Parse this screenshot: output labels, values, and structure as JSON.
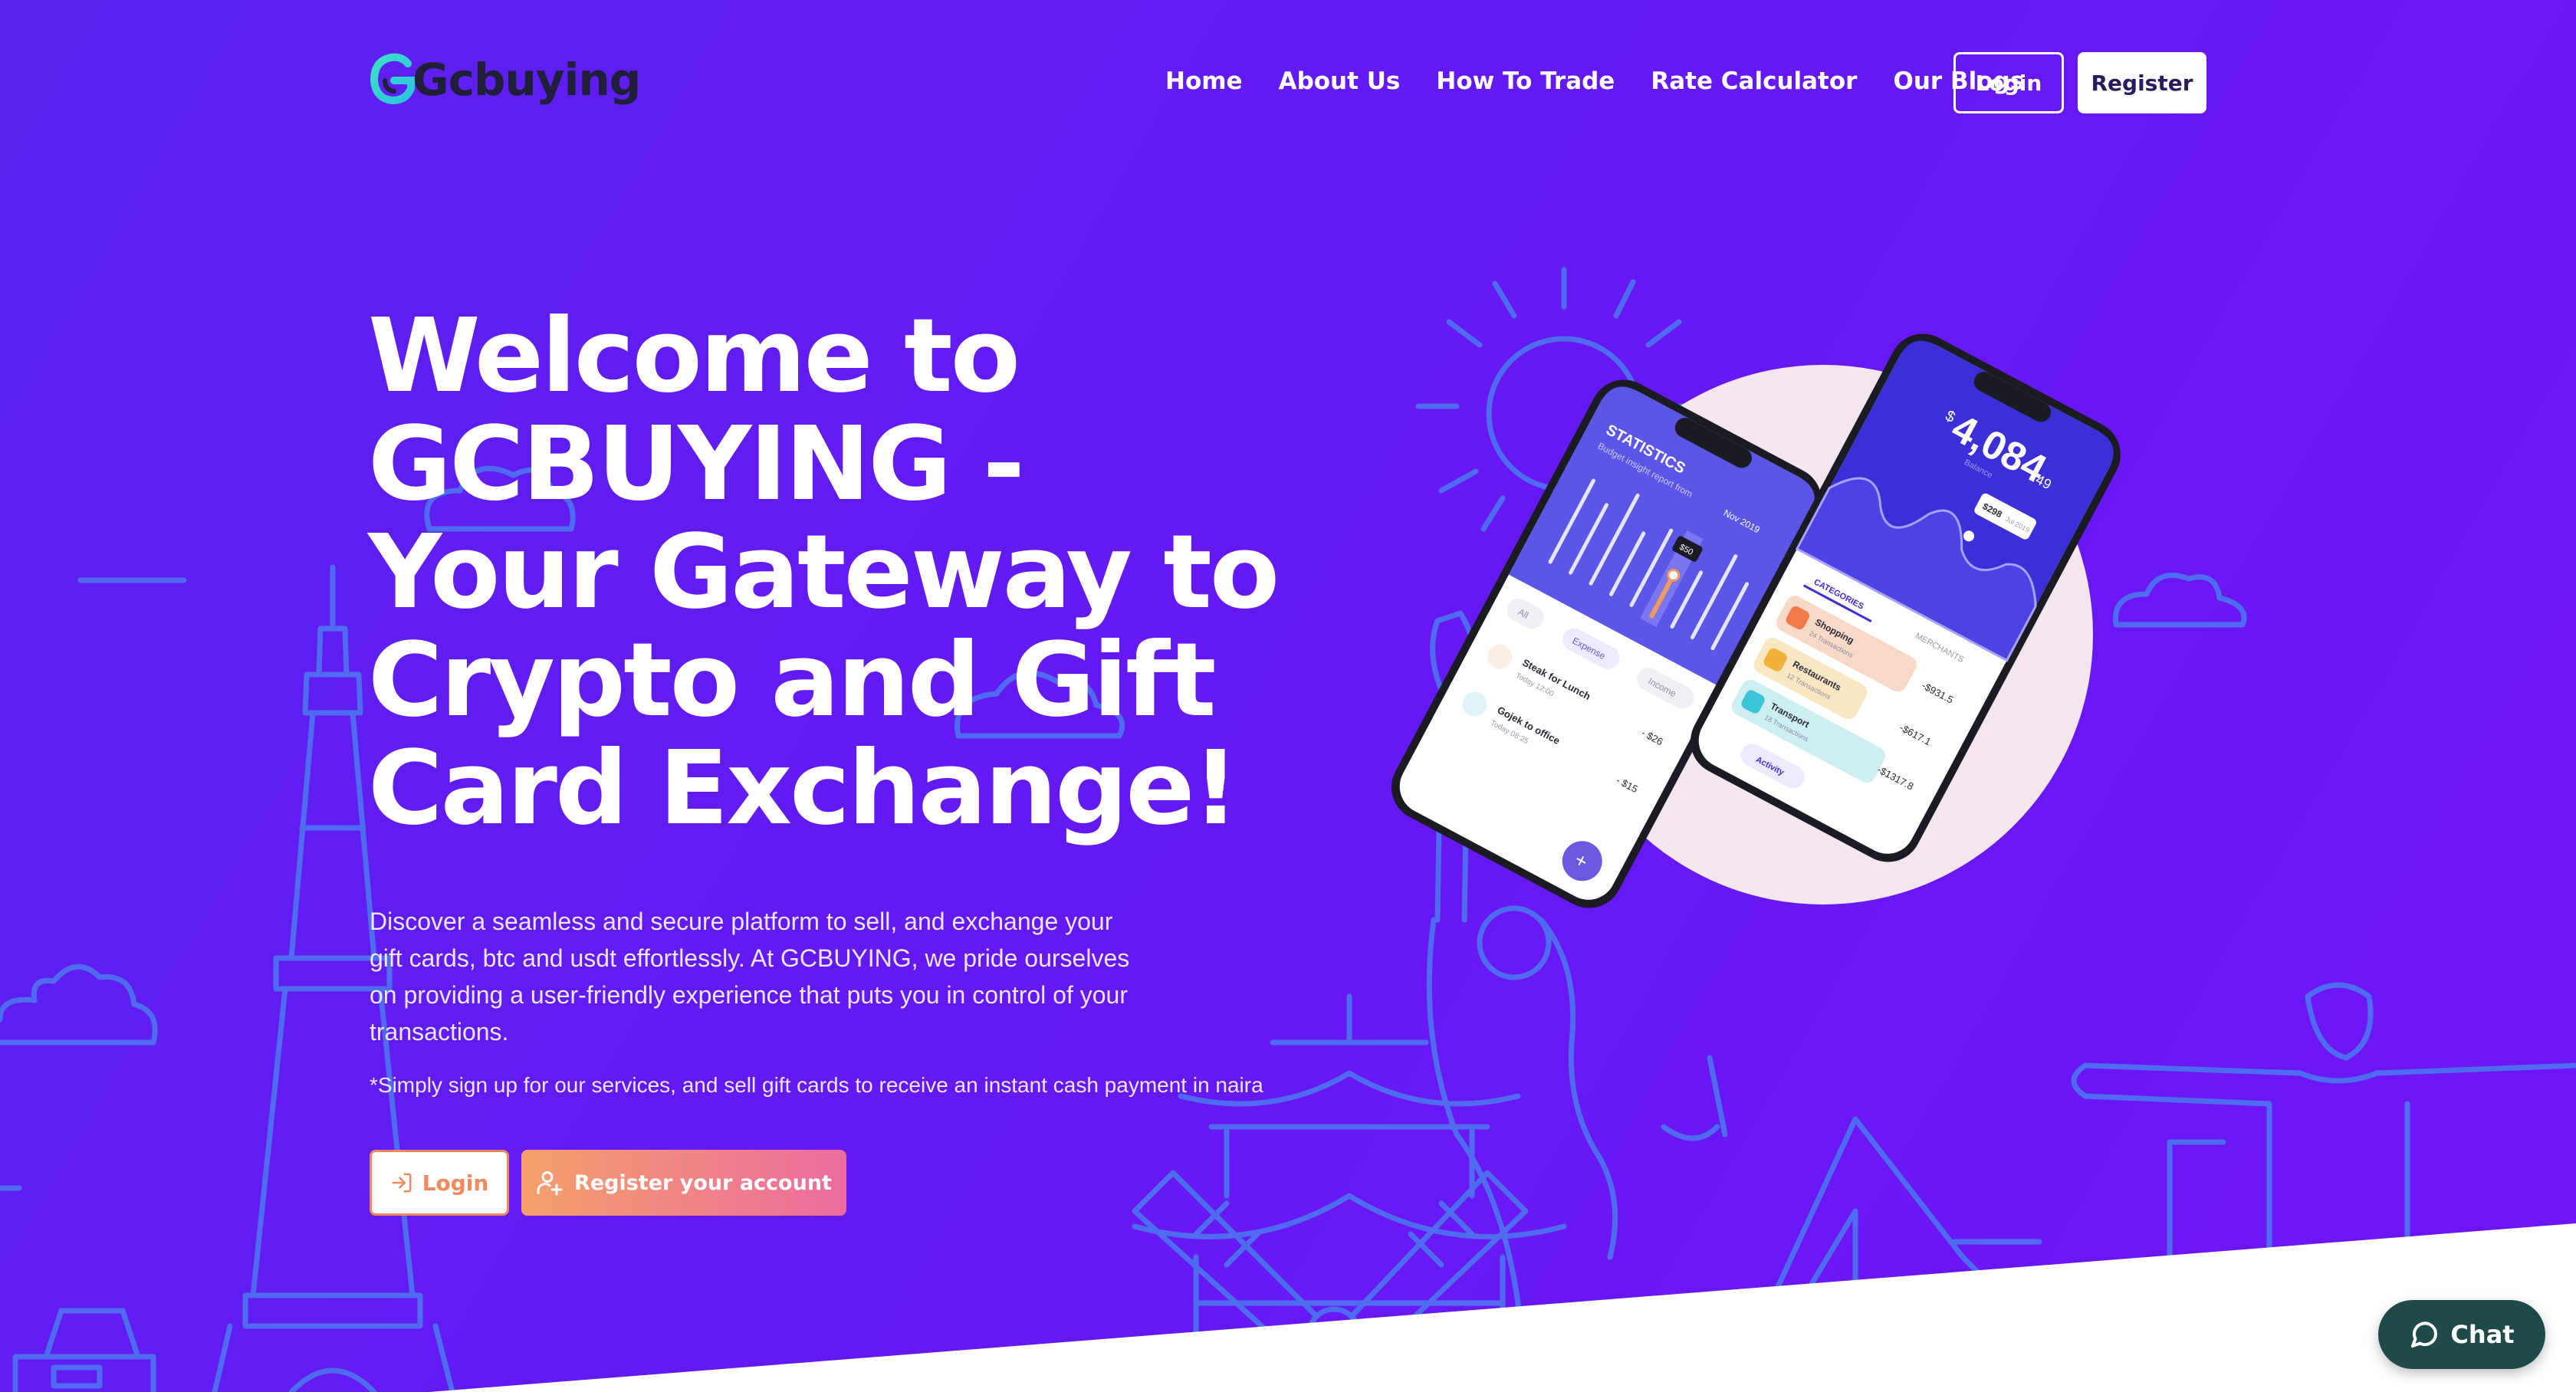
{
  "header": {
    "logo_text": "Gcbuying",
    "nav": [
      {
        "label": "Home"
      },
      {
        "label": "About Us"
      },
      {
        "label": "How To Trade"
      },
      {
        "label": "Rate Calculator"
      },
      {
        "label": "Our Blogs"
      }
    ],
    "login_label": "Login",
    "register_label": "Register"
  },
  "hero": {
    "headline_lines": [
      "Welcome to",
      "GCBUYING -",
      "Your Gateway to",
      "Crypto and Gift",
      "Card Exchange!"
    ],
    "lead": "Discover a seamless and secure platform to sell, and exchange your gift cards, btc and usdt effortlessly. At GCBUYING, we pride ourselves on providing a user-friendly experience that puts you in control of your transactions.",
    "note": "*Simply sign up for our services, and sell gift cards to receive an instant cash payment in naira",
    "login_label": "Login",
    "register_label": "Register your account"
  },
  "phones": {
    "left": {
      "title": "STATISTICS",
      "subtitle": "Budget insight report from",
      "period": "Nov 2019",
      "tag": "$50",
      "filters": [
        "All",
        "Expense",
        "Income"
      ],
      "transactions": [
        {
          "name": "Steak for Lunch",
          "meta": "Today 12:00",
          "amount": "- $26"
        },
        {
          "name": "Gojek to office",
          "meta": "Today 08:25",
          "amount": "- $15"
        }
      ]
    },
    "right": {
      "balance_symbol": "$",
      "balance_main": "4,084",
      "balance_cents": ".49",
      "balance_label": "Balance",
      "tooltip": "$298",
      "tooltip_sub": "Jul 2019",
      "tabs": [
        "CATEGORIES",
        "MERCHANTS"
      ],
      "categories": [
        {
          "name": "Shopping",
          "meta": "24 Transactions",
          "amount": "-$931.5",
          "color": "#f7d9c8",
          "icon_color": "#f07a4a"
        },
        {
          "name": "Restaurants",
          "meta": "12 Transactions",
          "amount": "-$617.1",
          "color": "#f9e7c2",
          "icon_color": "#f2b13c"
        },
        {
          "name": "Transport",
          "meta": "18 Transactions",
          "amount": "-$1317.8",
          "color": "#cdeff3",
          "icon_color": "#3bc4d6"
        }
      ],
      "activity_label": "Activity"
    }
  },
  "chat": {
    "label": "Chat"
  },
  "colors": {
    "hero_bg": "#6419f2",
    "accent_orange": "#f08a5d",
    "accent_pink": "#ec6aa0",
    "chat_bg": "#1f4a4a",
    "line_art": "#4f6cf0"
  }
}
